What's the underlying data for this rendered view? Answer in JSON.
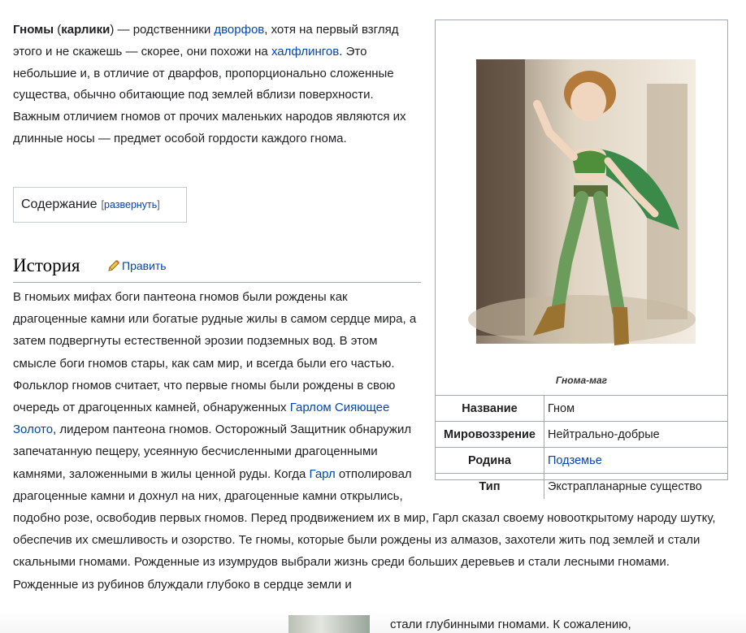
{
  "intro": {
    "term": "Гномы",
    "alias": "карлики",
    "t1": " — родственники ",
    "link1": "дворфов",
    "t2": ", хотя на первый взгляд этого и не скажешь — скорее, они похожи на ",
    "link2": "халфлингов",
    "t3": ". Это небольшие и, в отличие от дварфов, пропорционально сложенные существа, обычно обитающие под землей вблизи поверхности. Важным отличием гномов от прочих маленьких народов являются их длинные носы — предмет особой гордости каждого гнома."
  },
  "toc": {
    "title": "Содержание",
    "toggle": "развернуть"
  },
  "section": {
    "title": "История",
    "edit": "Править"
  },
  "body": {
    "p1": "В гномьих мифах боги пантеона гномов были рождены как драгоценные камни или богатые рудные жилы в самом сердце мира, а затем подвергнуты естественной эрозии подземных вод. В этом смысле боги гномов стары, как сам мир, и всегда были его частью. Фольклор гномов считает, что первые гномы были рождены в свою очередь от драгоценных камней, обнаруженных ",
    "link1": "Гарлом Сияющее Золото",
    "p2": ", лидером пантеона гномов. Осторожный Защитник обнаружил запечатанную пещеру, усеянную бесчисленными драгоценными камнями, заложенными в жилы ценной руды. Когда ",
    "link2": "Гарл",
    "p3": " отполировал драгоценные камни и дохнул на них, драгоценные камни открылись, подобно розе, освободив первых гномов. Перед продвижением их в мир, Гарл сказал своему новооткрытому народу шутку, обеспечив их смешливость и озорство. Те гномы, которые были рождены из алмазов, захотели жить под землей и стали скальными гномами. Рожденные из изумрудов выбрали жизнь среди больших деревьев и стали лесными гномами. Рожденные из рубинов блуждали глубоко в сердце земли и",
    "last_line": "стали глубинными гномами. К сожалению,"
  },
  "infobox": {
    "caption": "Гнома-маг",
    "rows": [
      {
        "label": "Название",
        "value": "Гном",
        "is_link": false
      },
      {
        "label": "Мировоззрение",
        "value": "Нейтрально-добрые",
        "is_link": false
      },
      {
        "label": "Родина",
        "value": "Подземье",
        "is_link": true
      },
      {
        "label": "Тип",
        "value": "Экстрапланарные существо",
        "is_link": false
      }
    ]
  },
  "colors": {
    "link": "#0645ad",
    "border": "#a2a9b1",
    "text": "#202122"
  }
}
